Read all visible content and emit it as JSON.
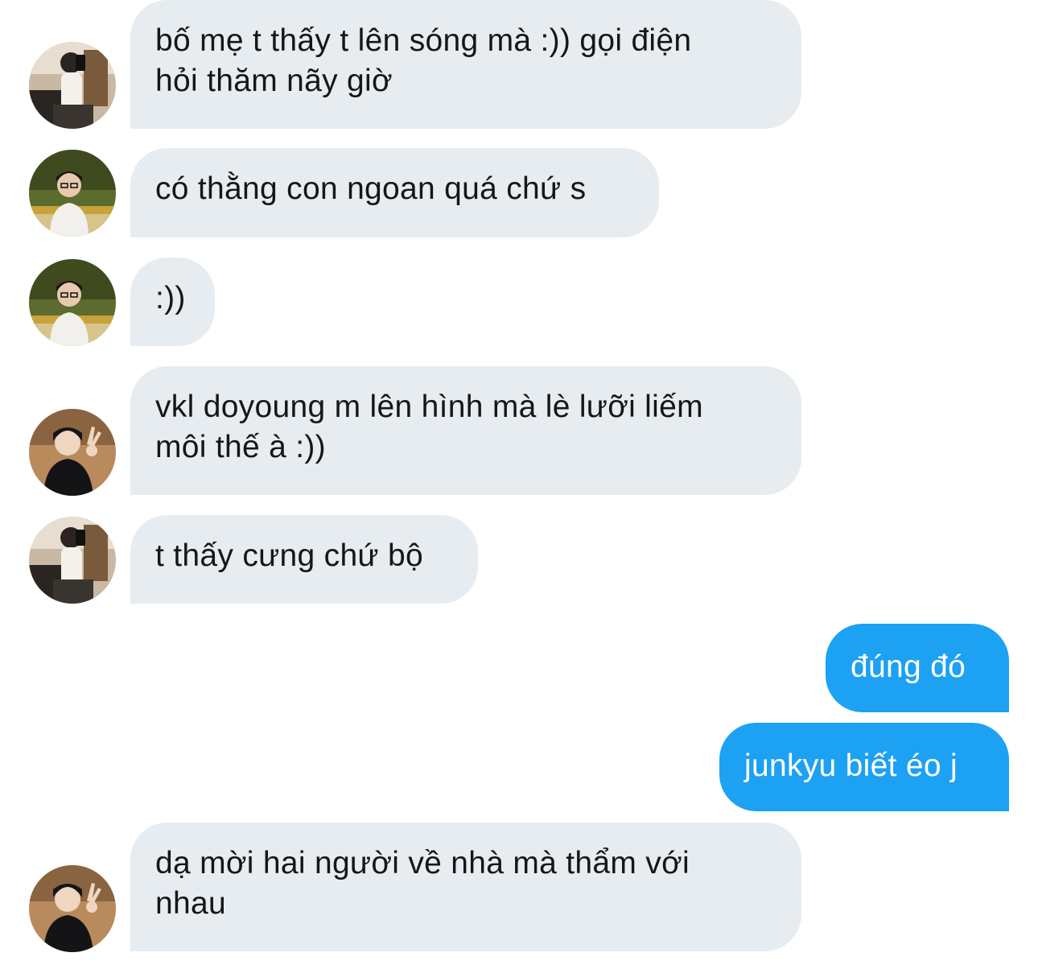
{
  "messages": [
    {
      "direction": "incoming",
      "avatar": "user-mirror-selfie-avatar",
      "text": "bố mẹ t thấy t lên sóng mà :)) gọi điện\nhỏi thăm nãy giờ"
    },
    {
      "direction": "incoming",
      "avatar": "user-glasses-avatar",
      "text": "có thằng con ngoan quá chứ s"
    },
    {
      "direction": "incoming",
      "avatar": "user-glasses-avatar",
      "text": ":))"
    },
    {
      "direction": "incoming",
      "avatar": "user-peace-sign-avatar",
      "text": "vkl doyoung m lên hình mà lè lưỡi liếm\nmôi thế à :))"
    },
    {
      "direction": "incoming",
      "avatar": "user-mirror-selfie-avatar",
      "text": "t thấy cưng chứ bộ"
    },
    {
      "direction": "outgoing",
      "text": "đúng đó"
    },
    {
      "direction": "outgoing",
      "text": "junkyu biết éo j"
    },
    {
      "direction": "incoming",
      "avatar": "user-peace-sign-avatar",
      "text": "dạ mời hai người về nhà mà thẩm với\nnhau"
    }
  ],
  "colors": {
    "incoming_bubble": "#e6ecf0",
    "incoming_text": "#14171a",
    "outgoing_bubble": "#1da1f2",
    "outgoing_text": "#ffffff",
    "background": "#ffffff"
  }
}
